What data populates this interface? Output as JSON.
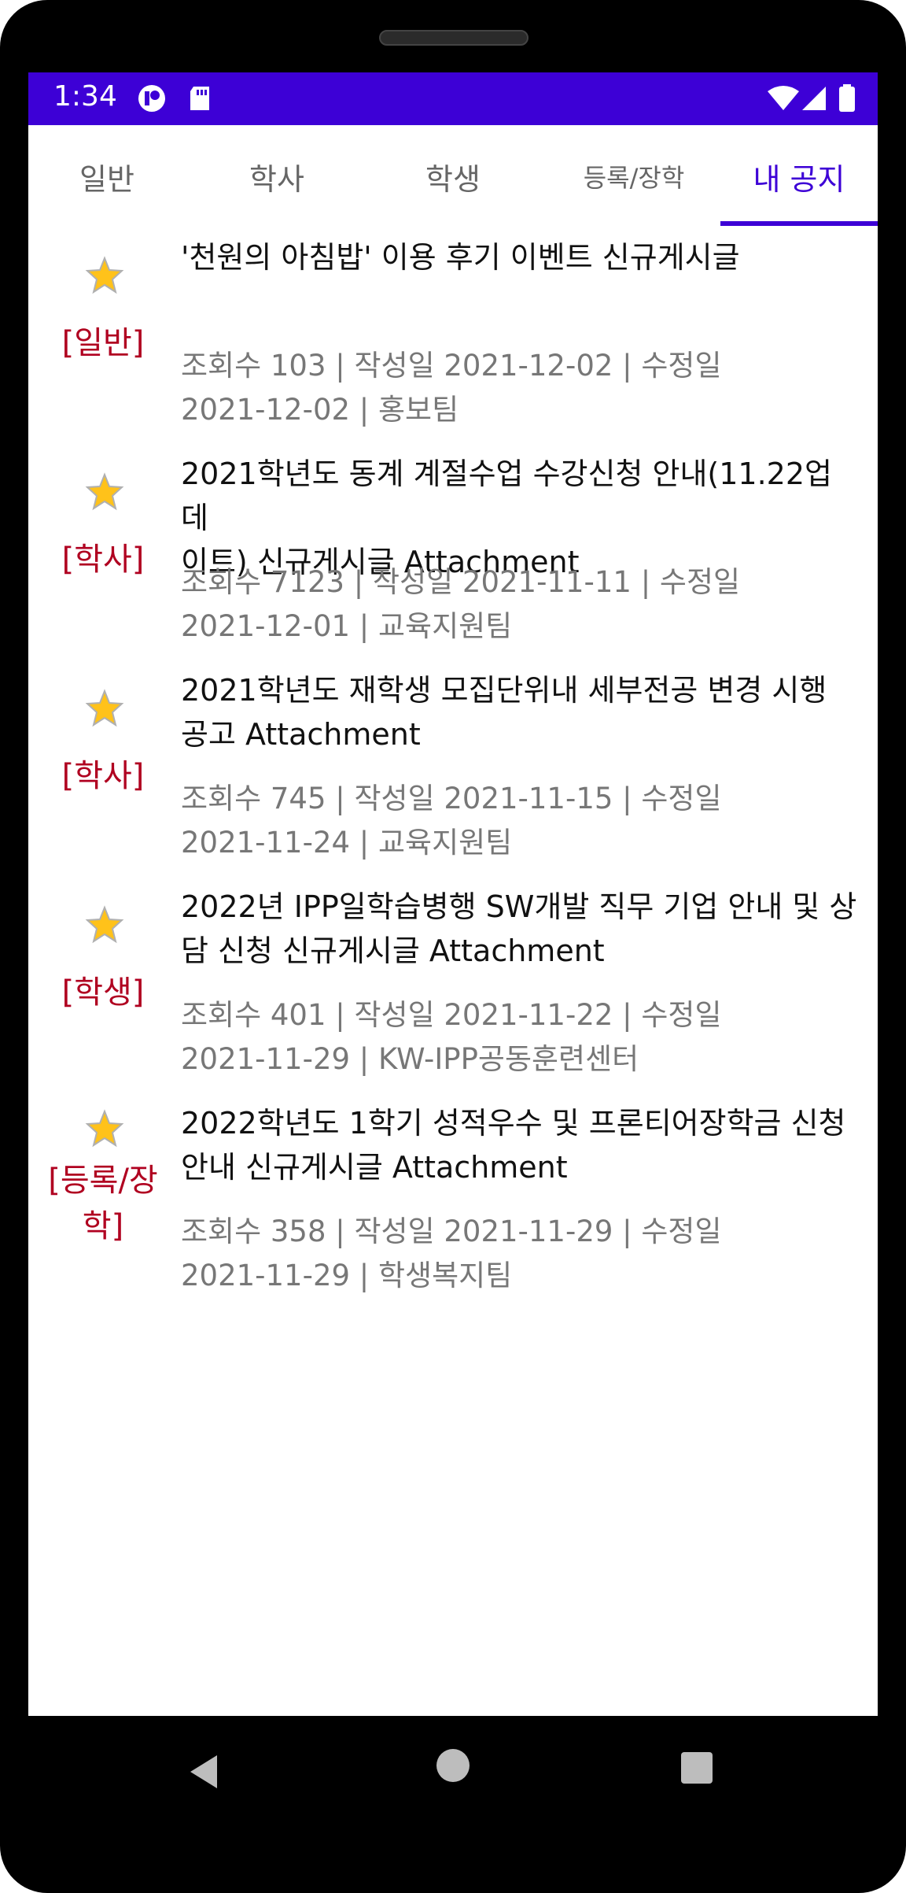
{
  "status": {
    "time": "1:34"
  },
  "tabs": [
    {
      "label": "일반"
    },
    {
      "label": "학사"
    },
    {
      "label": "학생"
    },
    {
      "label": "등록/장학"
    },
    {
      "label": "내 공지"
    }
  ],
  "notices": [
    {
      "category": "[일반]",
      "title_line1": " '천원의 아침밥' 이용 후기 이벤트 신규게시글",
      "title_line2": "",
      "meta_line1": "조회수 103 | 작성일 2021-12-02 | 수정일",
      "meta_line2": "2021-12-02 | 홍보팀"
    },
    {
      "category": "[학사]",
      "title_line1": " 2021학년도 동계 계절수업 수강신청 안내(11.22업데",
      "title_line2": "이트) 신규게시글 Attachment",
      "meta_line1": "조회수 7123 | 작성일 2021-11-11 | 수정일",
      "meta_line2": "2021-12-01 | 교육지원팀"
    },
    {
      "category": "[학사]",
      "title_line1": " 2021학년도 재학생 모집단위내 세부전공 변경 시행",
      "title_line2": "공고 Attachment",
      "meta_line1": "조회수 745 | 작성일 2021-11-15 | 수정일",
      "meta_line2": "2021-11-24 | 교육지원팀"
    },
    {
      "category": "[학생]",
      "title_line1": " 2022년 IPP일학습병행 SW개발 직무 기업 안내 및 상",
      "title_line2": "담 신청 신규게시글 Attachment",
      "meta_line1": "조회수 401 | 작성일 2021-11-22 | 수정일",
      "meta_line2": "2021-11-29 | KW-IPP공동훈련센터"
    },
    {
      "category_line1": "[등록/장",
      "category_line2": "학]",
      "title_line1": " 2022학년도 1학기 성적우수 및 프론티어장학금 신청",
      "title_line2": "안내 신규게시글 Attachment",
      "meta_line1": "조회수 358 | 작성일 2021-11-29 | 수정일",
      "meta_line2": "2021-11-29 | 학생복지팀"
    }
  ],
  "colors": {
    "accent": "#3d00d6",
    "category": "#b00020",
    "meta": "#777777"
  }
}
